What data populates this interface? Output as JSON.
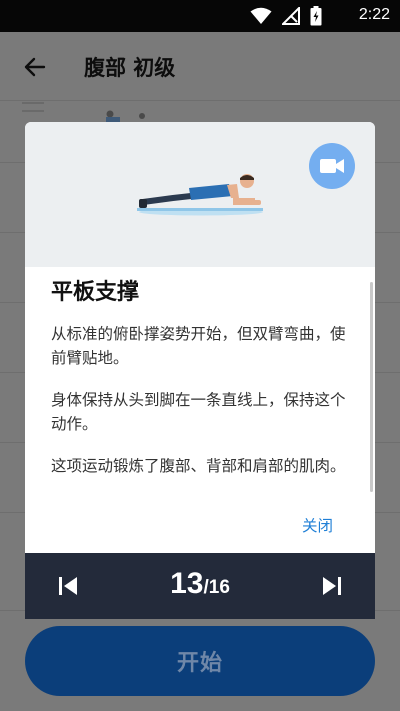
{
  "status_bar": {
    "time": "2:22"
  },
  "app_bar": {
    "title": "腹部 初级"
  },
  "start_button": {
    "label": "开始"
  },
  "dialog": {
    "exercise_title": "平板支撑",
    "description": [
      "从标准的俯卧撑姿势开始，但双臂弯曲，使前臂贴地。",
      "身体保持从头到脚在一条直线上，保持这个动作。",
      "这项运动锻炼了腹部、背部和肩部的肌肉。"
    ],
    "close_label": "关闭",
    "counter": {
      "current": "13",
      "total": "/16"
    }
  },
  "colors": {
    "accent": "#1f7fd6",
    "nav_bar": "#232a3a",
    "video_button": "#74aef0",
    "start_button": "#0b3e7a"
  },
  "icons": [
    "wifi-icon",
    "signal-icon",
    "battery-icon",
    "back-arrow-icon",
    "video-camera-icon",
    "skip-previous-icon",
    "skip-next-icon"
  ]
}
